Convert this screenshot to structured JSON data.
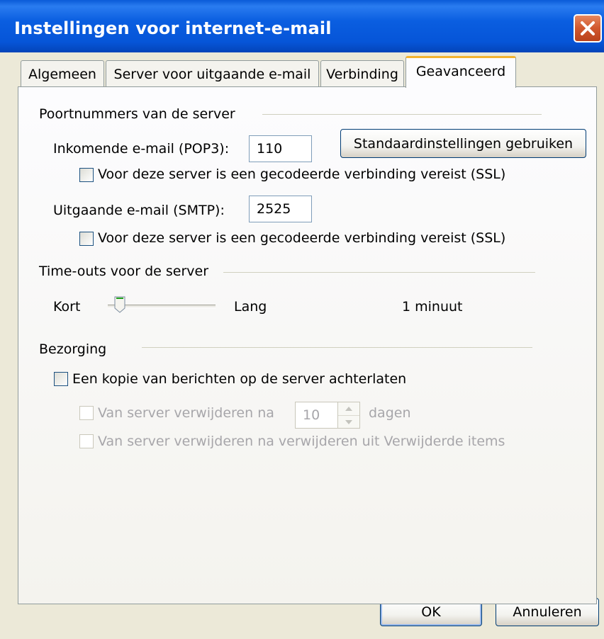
{
  "window": {
    "title": "Instellingen voor internet-e-mail"
  },
  "tabs": [
    {
      "label": "Algemeen"
    },
    {
      "label": "Server voor uitgaande e-mail"
    },
    {
      "label": "Verbinding"
    },
    {
      "label": "Geavanceerd",
      "active": true
    }
  ],
  "ports": {
    "heading": "Poortnummers van de server",
    "incoming_label": "Inkomende e-mail (POP3):",
    "incoming_value": "110",
    "default_button": "Standaardinstellingen gebruiken",
    "incoming_ssl": "Voor deze server is een gecodeerde verbinding vereist (SSL)",
    "incoming_ssl_checked": false,
    "outgoing_label": "Uitgaande e-mail (SMTP):",
    "outgoing_value": "2525",
    "outgoing_ssl": "Voor deze server is een gecodeerde verbinding vereist (SSL)",
    "outgoing_ssl_checked": false
  },
  "timeouts": {
    "heading": "Time-outs voor de server",
    "short_label": "Kort",
    "long_label": "Lang",
    "value_text": "1 minuut",
    "slider_level": 0.1
  },
  "delivery": {
    "heading": "Bezorging",
    "leave_copy": "Een kopie van berichten op de server achterlaten",
    "leave_copy_checked": false,
    "remove_after_label": "Van server verwijderen na",
    "remove_after_days": "10",
    "days_label": "dagen",
    "remove_when_deleted": "Van server verwijderen na verwijderen uit Verwijderde items"
  },
  "footer": {
    "ok": "OK",
    "cancel": "Annuleren"
  },
  "colors": {
    "titlebar": "#0655d8",
    "close": "#d1572d",
    "active_tab_accent": "#f2b330",
    "disabled_text": "#a7a6aa"
  }
}
